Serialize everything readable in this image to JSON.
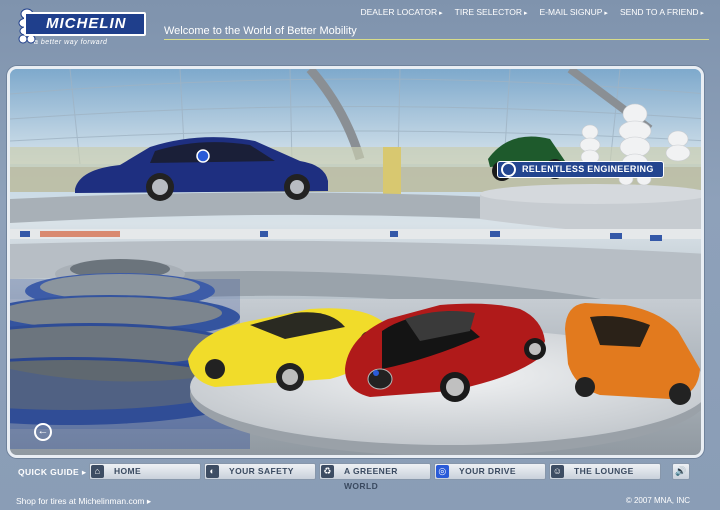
{
  "brand": {
    "name": "MICHELIN",
    "tagline": "a better way forward"
  },
  "header": {
    "welcome": "Welcome to the World of Better Mobility",
    "links": [
      "DEALER LOCATOR",
      "TIRE SELECTOR",
      "E-MAIL SIGNUP",
      "SEND TO A FRIEND"
    ]
  },
  "scene": {
    "badge": "RELENTLESS ENGINEERING"
  },
  "nav": {
    "quick_guide": "QUICK GUIDE",
    "items": [
      {
        "label": "HOME",
        "icon": "home-icon"
      },
      {
        "label": "YOUR SAFETY",
        "icon": "safety-icon"
      },
      {
        "label": "A GREENER WORLD",
        "icon": "recycle-icon"
      },
      {
        "label": "YOUR DRIVE",
        "icon": "steering-wheel-icon"
      },
      {
        "label": "THE LOUNGE",
        "icon": "smiley-icon"
      }
    ]
  },
  "footer": {
    "shop": "Shop for tires at Michelinman.com",
    "copyright": "© 2007 MNA, INC"
  }
}
